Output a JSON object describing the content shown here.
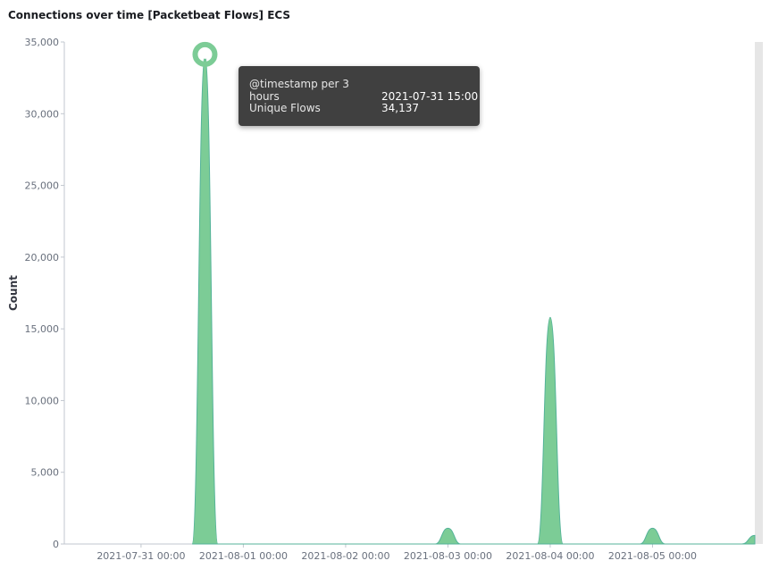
{
  "panel": {
    "title": "Connections over time [Packetbeat Flows] ECS"
  },
  "colors": {
    "series": "#54b399",
    "fill": "#7ccc96",
    "highlight": "#7ccc96",
    "grid": "#d3dae6",
    "tooltip_bg": "#404040"
  },
  "tooltip": {
    "rows": [
      {
        "key": "@timestamp per 3 hours",
        "value": "2021-07-31 15:00"
      },
      {
        "key": "Unique Flows",
        "value": "34,137"
      }
    ]
  },
  "chart_data": {
    "type": "area",
    "title": "Connections over time [Packetbeat Flows] ECS",
    "xlabel": "",
    "ylabel": "Count",
    "ylim": [
      0,
      35000
    ],
    "yticks": [
      0,
      5000,
      10000,
      15000,
      20000,
      25000,
      30000,
      35000
    ],
    "ytick_labels": [
      "0",
      "5,000",
      "10,000",
      "15,000",
      "20,000",
      "25,000",
      "30,000",
      "35,000"
    ],
    "xticks": [
      "2021-07-31 00:00",
      "2021-08-01 00:00",
      "2021-08-02 00:00",
      "2021-08-03 00:00",
      "2021-08-04 00:00",
      "2021-08-05 00:00"
    ],
    "xrange": [
      "2021-07-30 06:00",
      "2021-08-06 00:00"
    ],
    "series": [
      {
        "name": "Unique Flows",
        "x": [
          "2021-07-31 12:00",
          "2021-07-31 15:00",
          "2021-07-31 18:00",
          "2021-08-02 21:00",
          "2021-08-03 00:00",
          "2021-08-03 03:00",
          "2021-08-03 21:00",
          "2021-08-04 00:00",
          "2021-08-04 03:00",
          "2021-08-04 21:00",
          "2021-08-05 00:00",
          "2021-08-05 03:00",
          "2021-08-05 21:00",
          "2021-08-06 00:00"
        ],
        "values": [
          0,
          34137,
          0,
          0,
          1100,
          0,
          0,
          15800,
          0,
          0,
          1100,
          0,
          0,
          600
        ]
      }
    ],
    "highlight": {
      "x": "2021-07-31 15:00",
      "y": 34137
    },
    "grid": false
  }
}
